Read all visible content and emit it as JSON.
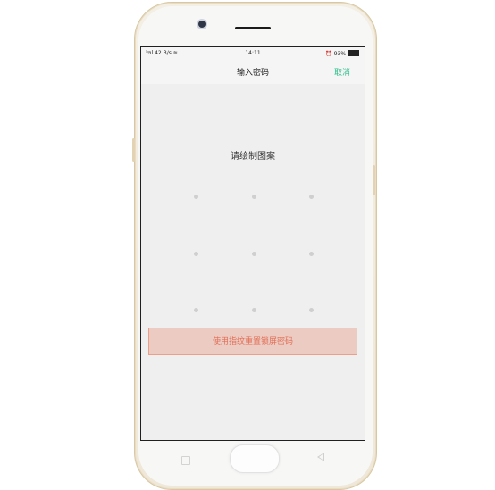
{
  "statusbar": {
    "left": "⁵ᵍıl 42 B/s ≋",
    "time": "14:11",
    "right": "⏰ 93%"
  },
  "header": {
    "title": "输入密码",
    "cancel_label": "取消"
  },
  "main": {
    "prompt": "请绘制图案",
    "pattern_grid": {
      "rows": 3,
      "cols": 3
    },
    "fingerprint_reset_label": "使用指纹重置锁屏密码"
  },
  "colors": {
    "accent": "#2fbf8c",
    "fingerprint_text": "#e26f56",
    "fingerprint_bg": "#eccbc3",
    "fingerprint_border": "#ee9d88",
    "dot": "#cfcfcf"
  }
}
